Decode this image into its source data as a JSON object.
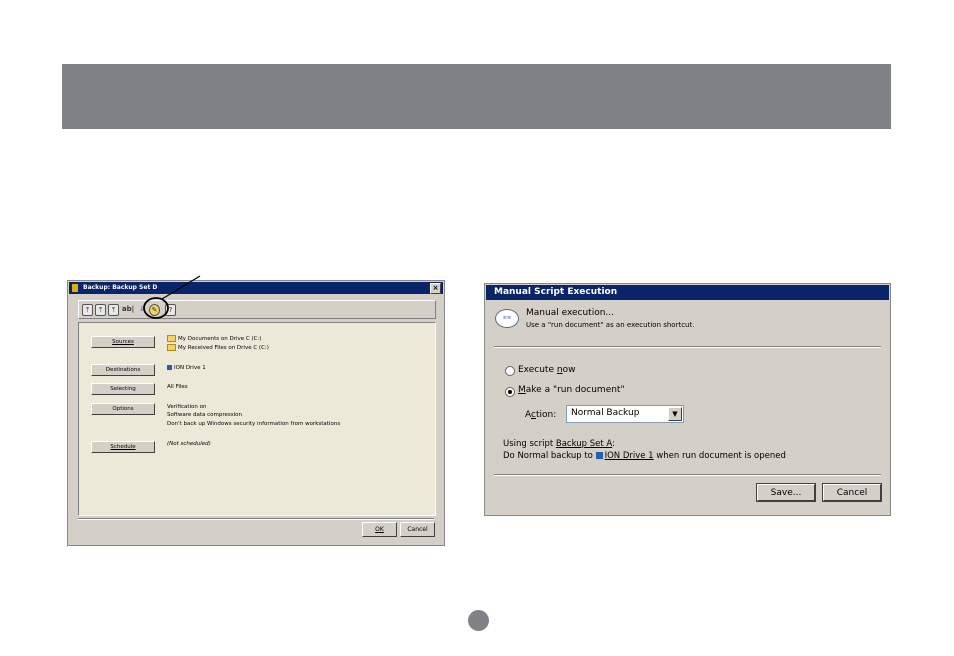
{
  "left_window": {
    "title": "Backup: Backup Set D",
    "close_glyph": "×",
    "toolbar_text": "ab|",
    "rows": {
      "sources_label": "Sources",
      "sources_line1": "My Documents on Drive C (C:)",
      "sources_line2": "My Received Files on Drive C (C:)",
      "destinations_label": "Destinations",
      "destinations_value": "ION Drive 1",
      "selecting_label": "Selecting",
      "selecting_value": "All Files",
      "options_label": "Options",
      "options_line1": "Verification on",
      "options_line2": "Software data compression",
      "options_line3": "Don't back up Windows security information from workstations",
      "schedule_label": "Schedule",
      "schedule_value": "(Not scheduled)"
    },
    "ok_label": "OK",
    "cancel_label": "Cancel"
  },
  "right_window": {
    "title": "Manual Script Execution",
    "header_title": "Manual execution...",
    "header_subtitle": "Use a \"run document\" as an execution shortcut.",
    "execute_now": {
      "prefix": "Execute ",
      "underlined": "n",
      "suffix": "ow"
    },
    "make_run_doc": {
      "underlined": "M",
      "suffix": "ake a \"run document\""
    },
    "action_label": {
      "prefix": "A",
      "underlined": "c",
      "suffix": "tion:"
    },
    "action_value": "Normal Backup",
    "script_line": {
      "prefix": "Using script ",
      "link": "Backup Set A",
      "suffix": ":"
    },
    "backup_line": {
      "prefix": "Do Normal backup to ",
      "link": "ION Drive 1",
      "suffix": " when run document is opened"
    },
    "save_label": "Save...",
    "cancel_label": "Cancel"
  },
  "colors": {
    "banner": "#808285",
    "titlebar": "#0a246a",
    "dialog_bg": "#d4d0c8"
  },
  "icons": [
    "backup-icon",
    "restore-icon",
    "rename-icon",
    "run-document-icon",
    "help-icon",
    "folder-icon",
    "drive-icon",
    "script-bubble-icon"
  ]
}
